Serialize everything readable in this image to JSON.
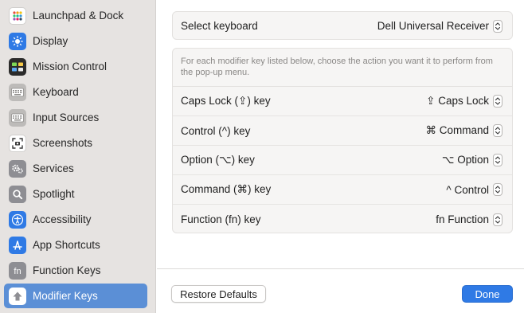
{
  "sidebar": {
    "items": [
      {
        "label": "Launchpad & Dock",
        "icon": "launchpad-dock-icon",
        "selected": false
      },
      {
        "label": "Display",
        "icon": "display-icon",
        "selected": false
      },
      {
        "label": "Mission Control",
        "icon": "mission-control-icon",
        "selected": false
      },
      {
        "label": "Keyboard",
        "icon": "keyboard-icon",
        "selected": false
      },
      {
        "label": "Input Sources",
        "icon": "input-sources-icon",
        "selected": false
      },
      {
        "label": "Screenshots",
        "icon": "screenshots-icon",
        "selected": false
      },
      {
        "label": "Services",
        "icon": "services-icon",
        "selected": false
      },
      {
        "label": "Spotlight",
        "icon": "spotlight-icon",
        "selected": false
      },
      {
        "label": "Accessibility",
        "icon": "accessibility-icon",
        "selected": false
      },
      {
        "label": "App Shortcuts",
        "icon": "app-shortcuts-icon",
        "selected": false
      },
      {
        "label": "Function Keys",
        "icon": "function-keys-icon",
        "selected": false
      },
      {
        "label": "Modifier Keys",
        "icon": "modifier-keys-icon",
        "selected": true
      }
    ]
  },
  "keyboard_select": {
    "label": "Select keyboard",
    "value": "Dell Universal Receiver"
  },
  "modifiers": {
    "description": "For each modifier key listed below, choose the action you want it to perform from the pop-up menu.",
    "rows": [
      {
        "label": "Caps Lock (⇪) key",
        "value": "⇪ Caps Lock"
      },
      {
        "label": "Control (^) key",
        "value": "⌘ Command"
      },
      {
        "label": "Option (⌥) key",
        "value": "⌥ Option"
      },
      {
        "label": "Command (⌘) key",
        "value": "^ Control"
      },
      {
        "label": "Function (fn) key",
        "value": "fn Function"
      }
    ]
  },
  "footer": {
    "restore_label": "Restore Defaults",
    "done_label": "Done"
  },
  "colors": {
    "sidebar_bg": "#e6e3e1",
    "selection": "#5b8fd6",
    "primary_button": "#2f7ae5"
  }
}
